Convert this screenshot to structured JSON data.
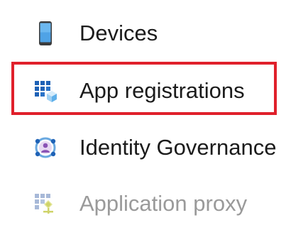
{
  "menu": {
    "items": [
      {
        "label": "Devices",
        "icon": "phone-icon",
        "enabled": true
      },
      {
        "label": "App registrations",
        "icon": "app-grid-icon",
        "enabled": true,
        "highlighted": true
      },
      {
        "label": "Identity Governance",
        "icon": "identity-governance-icon",
        "enabled": true
      },
      {
        "label": "Application proxy",
        "icon": "application-proxy-icon",
        "enabled": false
      }
    ]
  },
  "colors": {
    "highlight_border": "#e0202b",
    "text": "#1b1b1b",
    "disabled_text": "#9a9a9a",
    "accent_blue": "#1f62b6"
  }
}
